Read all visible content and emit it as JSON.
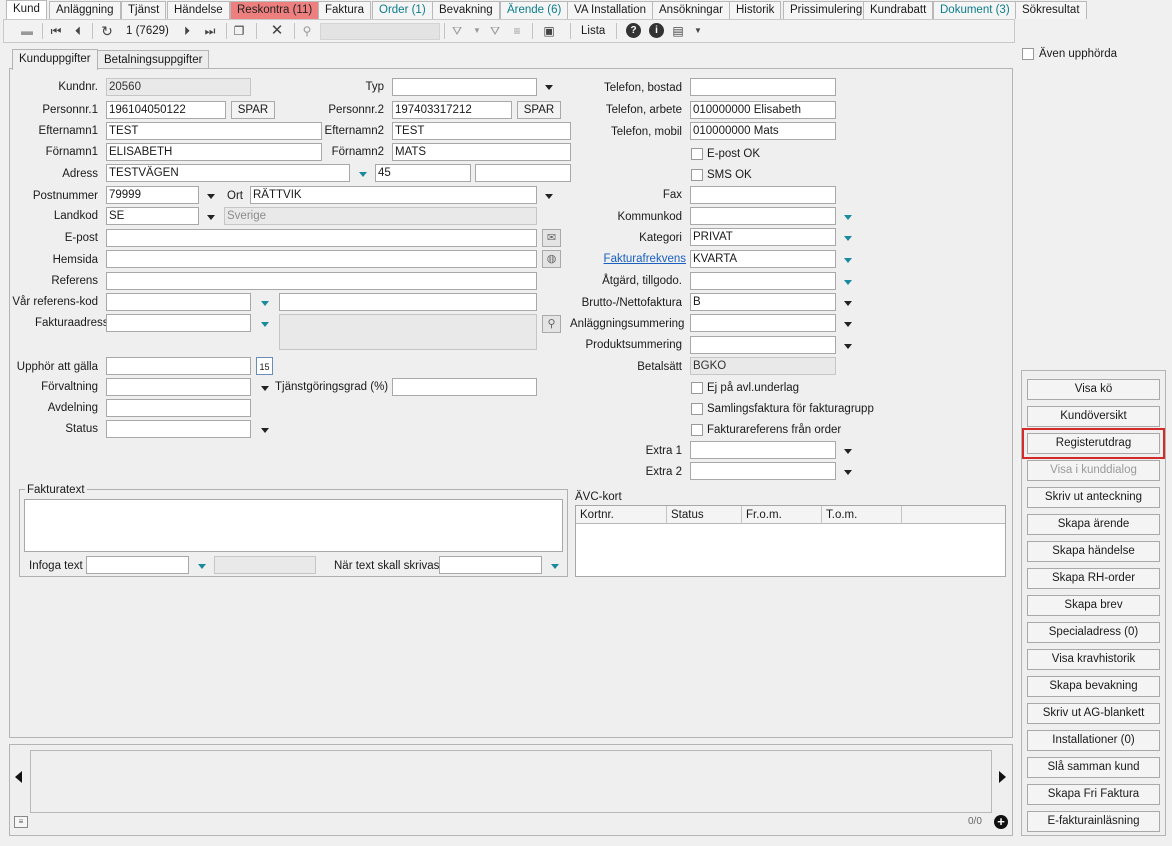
{
  "tabs": [
    {
      "label": "Kund",
      "style": "active"
    },
    {
      "label": "Anläggning",
      "style": ""
    },
    {
      "label": "Tjänst",
      "style": ""
    },
    {
      "label": "Händelse",
      "style": ""
    },
    {
      "label": "Reskontra (11)",
      "style": "alert"
    },
    {
      "label": "Faktura",
      "style": ""
    },
    {
      "label": "Order (1)",
      "style": "teal"
    },
    {
      "label": "Bevakning",
      "style": ""
    },
    {
      "label": "Ärende (6)",
      "style": "teal"
    },
    {
      "label": "VA Installation",
      "style": ""
    },
    {
      "label": "Ansökningar",
      "style": ""
    },
    {
      "label": "Historik",
      "style": ""
    },
    {
      "label": "Prissimulering",
      "style": ""
    },
    {
      "label": "Kundrabatt",
      "style": ""
    },
    {
      "label": "Dokument (3)",
      "style": "teal"
    },
    {
      "label": "Sökresultat",
      "style": ""
    }
  ],
  "toolbar": {
    "record_counter": "1 (7629)",
    "list_label": "Lista"
  },
  "aven_upphorda": "Även upphörda",
  "subtabs": {
    "kunduppgifter": "Kunduppgifter",
    "betalningsuppgifter": "Betalningsuppgifter"
  },
  "left": {
    "kundnr_label": "Kundnr.",
    "kundnr": "20560",
    "typ_label": "Typ",
    "typ": "",
    "personnr1_label": "Personnr.1",
    "personnr1": "196104050122",
    "personnr2_label": "Personnr.2",
    "personnr2": "197403317212",
    "spar_label": "SPAR",
    "efternamn1_label": "Efternamn1",
    "efternamn1": "TEST",
    "efternamn2_label": "Efternamn2",
    "efternamn2": "TEST",
    "fornamn1_label": "Förnamn1",
    "fornamn1": "ELISABETH",
    "fornamn2_label": "Förnamn2",
    "fornamn2": "MATS",
    "adress_label": "Adress",
    "adress": "TESTVÄGEN",
    "adress_nr": "45",
    "adress_extra": "",
    "postnummer_label": "Postnummer",
    "postnummer": "79999",
    "ort_label": "Ort",
    "ort": "RÄTTVIK",
    "landkod_label": "Landkod",
    "landkod": "SE",
    "land": "Sverige",
    "epost_label": "E-post",
    "epost": "",
    "hemsida_label": "Hemsida",
    "hemsida": "",
    "referens_label": "Referens",
    "referens": "",
    "var_referens_label": "Vår referens-kod",
    "var_referens": "",
    "fakturaadress_label": "Fakturaadress",
    "fakturaadress": "",
    "upphor_label": "Upphör att gälla",
    "upphor": "",
    "calendar_day": "15",
    "forvaltning_label": "Förvaltning",
    "forvaltning": "",
    "tjanstgoringsgrad_label": "Tjänstgöringsgrad (%)",
    "tjanstgoringsgrad": "",
    "avdelning_label": "Avdelning",
    "avdelning": "",
    "status_label": "Status",
    "status": ""
  },
  "right": {
    "tel_bostad_label": "Telefon, bostad",
    "tel_bostad": "",
    "tel_arbete_label": "Telefon, arbete",
    "tel_arbete": "010000000 Elisabeth",
    "tel_mobil_label": "Telefon, mobil",
    "tel_mobil": "010000000 Mats",
    "epost_ok_label": "E-post OK",
    "sms_ok_label": "SMS OK",
    "fax_label": "Fax",
    "fax": "",
    "kommunkod_label": "Kommunkod",
    "kommunkod": "",
    "kategori_label": "Kategori",
    "kategori": "PRIVAT",
    "fakturafrekvens_label": "Fakturafrekvens",
    "fakturafrekvens": "KVARTA",
    "atgard_label": "Åtgärd, tillgodo.",
    "atgard": "",
    "brutto_label": "Brutto-/Nettofaktura",
    "brutto": "B",
    "anlaggningssummering_label": "Anläggningsummering",
    "anlaggningssummering": "",
    "produktsummering_label": "Produktsummering",
    "produktsummering": "",
    "betalsatt_label": "Betalsätt",
    "betalsatt": "BGKO",
    "ej_avl_label": "Ej på avl.underlag",
    "samlingsfaktura_label": "Samlingsfaktura för fakturagrupp",
    "fakturareferens_label": "Fakturareferens från order",
    "extra1_label": "Extra 1",
    "extra1": "",
    "extra2_label": "Extra 2",
    "extra2": ""
  },
  "fakturatext": {
    "title": "Fakturatext",
    "infoga_label": "Infoga text",
    "nar_label": "När text skall skrivas"
  },
  "avc": {
    "title": "ÄVC-kort",
    "columns": [
      "Kortnr.",
      "Status",
      "Fr.o.m.",
      "T.o.m."
    ]
  },
  "right_buttons": [
    {
      "label": "Visa kö",
      "state": ""
    },
    {
      "label": "Kundöversikt",
      "state": ""
    },
    {
      "label": "Registerutdrag",
      "state": "highlight"
    },
    {
      "label": "Visa i kunddialog",
      "state": "disabled"
    },
    {
      "label": "Skriv ut anteckning",
      "state": ""
    },
    {
      "label": "Skapa ärende",
      "state": ""
    },
    {
      "label": "Skapa händelse",
      "state": ""
    },
    {
      "label": "Skapa RH-order",
      "state": ""
    },
    {
      "label": "Skapa brev",
      "state": ""
    },
    {
      "label": "Specialadress (0)",
      "state": ""
    },
    {
      "label": "Visa kravhistorik",
      "state": ""
    },
    {
      "label": "Skapa bevakning",
      "state": ""
    },
    {
      "label": "Skriv ut AG-blankett",
      "state": ""
    },
    {
      "label": "Installationer (0)",
      "state": ""
    },
    {
      "label": "Slå samman kund",
      "state": ""
    },
    {
      "label": "Skapa Fri Faktura",
      "state": ""
    },
    {
      "label": "E-fakturainläsning",
      "state": ""
    }
  ],
  "notes_counter": "0/0",
  "colors": {
    "alert_tab": "#ee7f7f",
    "teal": "#0b7d8c",
    "highlight": "#d32a2a"
  }
}
